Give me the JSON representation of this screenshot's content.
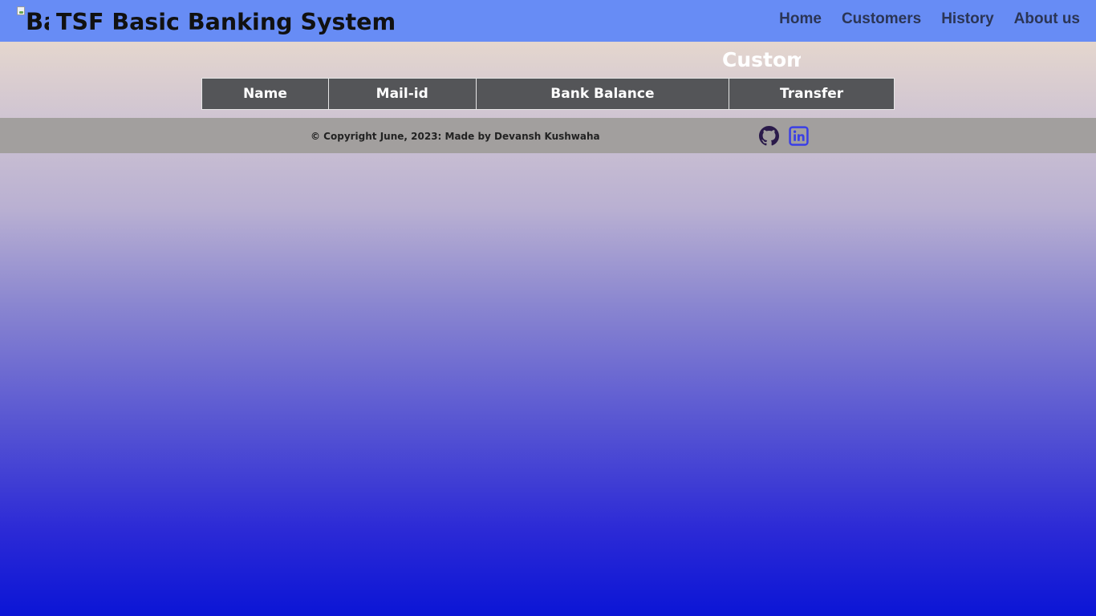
{
  "header": {
    "logo_alt": "Ba",
    "title": "TSF Basic Banking System",
    "nav": [
      {
        "label": "Home"
      },
      {
        "label": "Customers"
      },
      {
        "label": "History"
      },
      {
        "label": "About us"
      }
    ]
  },
  "main": {
    "section_title": "Customers",
    "table": {
      "columns": [
        "Name",
        "Mail-id",
        "Bank Balance",
        "Transfer"
      ],
      "rows": []
    }
  },
  "footer": {
    "copyright": "© Copyright June, 2023: Made by Devansh Kushwaha",
    "social": [
      {
        "icon": "github-icon",
        "color": "#2a1a4a"
      },
      {
        "icon": "linkedin-icon",
        "color": "#3a3fe6"
      }
    ]
  },
  "colors": {
    "navbar": "#678cf5",
    "table_header": "#545558",
    "footer": "#a29f9e",
    "nav_text": "#2b3555"
  }
}
